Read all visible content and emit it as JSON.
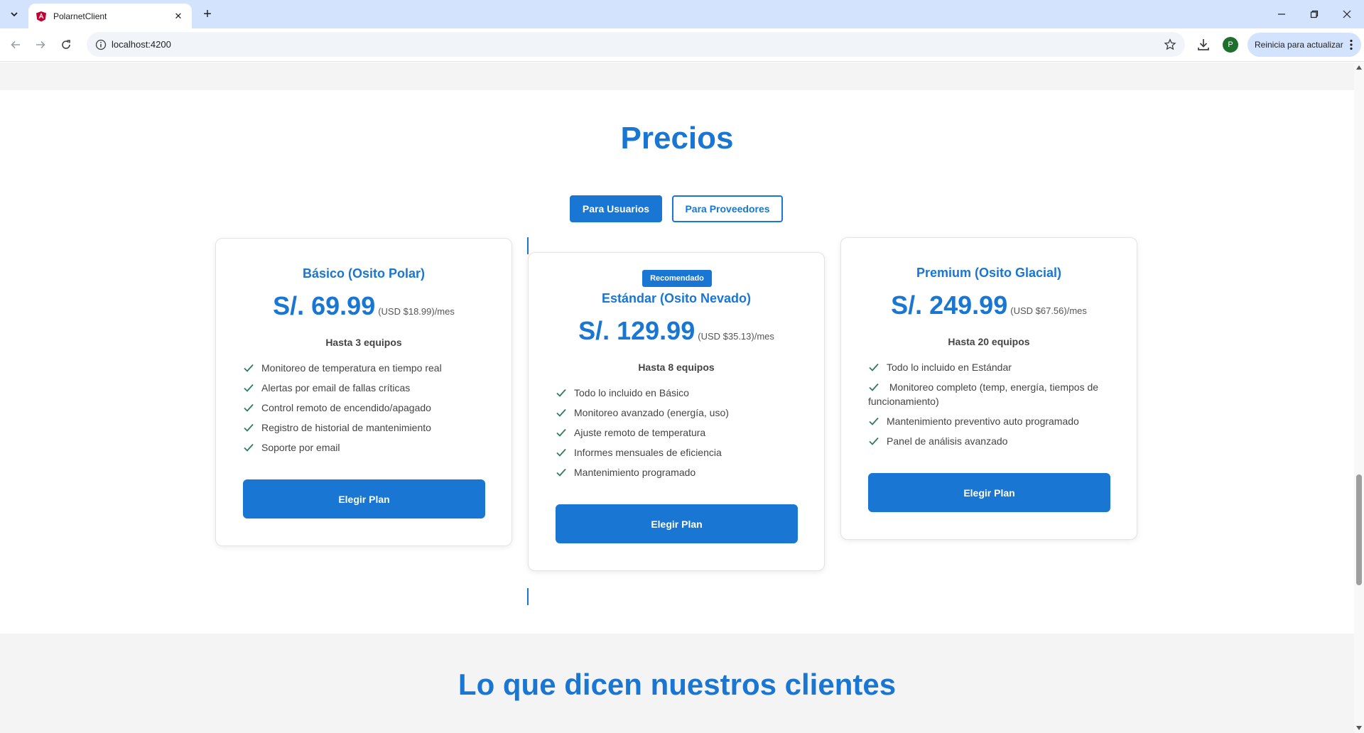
{
  "browser": {
    "tab_title": "PolarnetClient",
    "url": "localhost:4200",
    "profile_initial": "P",
    "update_label": "Reinicia para actualizar",
    "colors": {
      "tabbar": "#d3e3fd",
      "profile": "#1e6e2c"
    }
  },
  "pricing": {
    "title": "Precios",
    "toggle": {
      "users": "Para Usuarios",
      "providers": "Para Proveedores",
      "selected": "users"
    },
    "plans": [
      {
        "name": "Básico (Osito Polar)",
        "price": "S/. 69.99",
        "price_usd": "(USD $18.99)/mes",
        "devices": "Hasta 3 equipos",
        "features": [
          "Monitoreo de temperatura en tiempo real",
          "Alertas por email de fallas críticas",
          "Control remoto de encendido/apagado",
          "Registro de historial de mantenimiento",
          "Soporte por email"
        ],
        "button": "Elegir Plan"
      },
      {
        "badge": "Recomendado",
        "name": "Estándar (Osito Nevado)",
        "price": "S/. 129.99",
        "price_usd": "(USD $35.13)/mes",
        "devices": "Hasta 8 equipos",
        "features": [
          "Todo lo incluido en Básico",
          "Monitoreo avanzado (energía, uso)",
          "Ajuste remoto de temperatura",
          "Informes mensuales de eficiencia",
          "Mantenimiento programado"
        ],
        "button": "Elegir Plan"
      },
      {
        "name": "Premium (Osito Glacial)",
        "price": "S/. 249.99",
        "price_usd": "(USD $67.56)/mes",
        "devices": "Hasta 20 equipos",
        "features": [
          "Todo lo incluido en Estándar",
          "Monitoreo completo (temp, energía, tiempos de funcionamiento)",
          "Mantenimiento preventivo auto programado",
          "Panel de análisis avanzado"
        ],
        "button": "Elegir Plan"
      }
    ],
    "colors": {
      "accent": "#1976d2",
      "check": "#2e7d5b"
    }
  },
  "testimonials": {
    "title": "Lo que dicen nuestros clientes"
  }
}
